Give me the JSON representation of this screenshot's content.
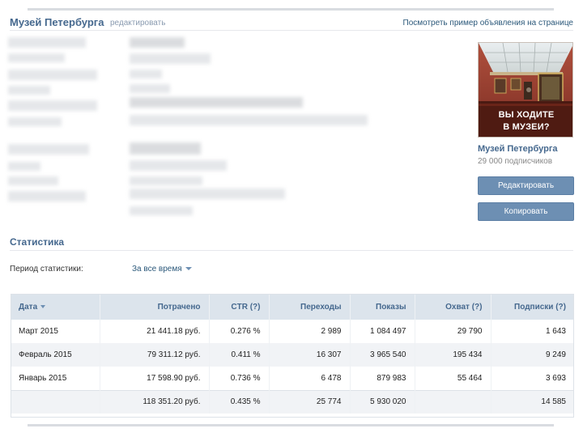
{
  "header": {
    "title": "Музей Петербурга",
    "edit_link": "редактировать",
    "preview_link": "Посмотреть пример объявления на странице"
  },
  "ad": {
    "image_line1": "ВЫ ХОДИТЕ",
    "image_line2": "В МУЗЕИ?",
    "name": "Музей Петербурга",
    "subscribers": "29 000 подписчиков",
    "edit_button": "Редактировать",
    "copy_button": "Копировать"
  },
  "stats": {
    "title": "Статистика",
    "period_label": "Период статистики:",
    "period_value": "За все время",
    "columns": [
      "Дата",
      "Потрачено",
      "CTR (?)",
      "Переходы",
      "Показы",
      "Охват (?)",
      "Подписки (?)"
    ],
    "rows": [
      [
        "Март 2015",
        "21 441.18 руб.",
        "0.276 %",
        "2 989",
        "1 084 497",
        "29 790",
        "1 643"
      ],
      [
        "Февраль 2015",
        "79 311.12 руб.",
        "0.411 %",
        "16 307",
        "3 965 540",
        "195 434",
        "9 249"
      ],
      [
        "Январь 2015",
        "17 598.90 руб.",
        "0.736 %",
        "6 478",
        "879 983",
        "55 464",
        "3 693"
      ]
    ],
    "total": [
      "",
      "118 351.20 руб.",
      "0.435 %",
      "25 774",
      "5 930 020",
      "",
      "14 585"
    ]
  },
  "colors": {
    "link": "#45688e",
    "button": "#6d8fb3",
    "table_header": "#dce4ec"
  }
}
